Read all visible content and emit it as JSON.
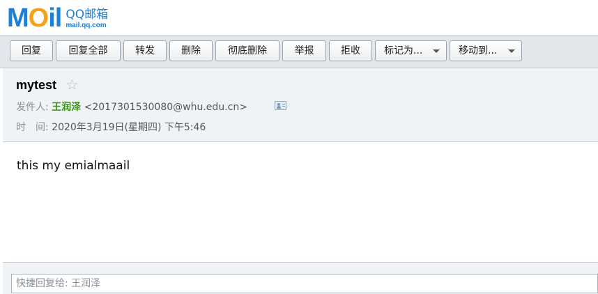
{
  "logo": {
    "mark": {
      "m": "M",
      "o": "O",
      "il": "il"
    },
    "brand": "QQ邮箱",
    "domain": "mail.qq.com"
  },
  "toolbar": {
    "buttons": [
      {
        "label": "回复"
      },
      {
        "label": "回复全部"
      },
      {
        "label": "转发"
      },
      {
        "label": "删除"
      },
      {
        "label": "彻底删除"
      },
      {
        "label": "举报"
      },
      {
        "label": "拒收"
      },
      {
        "label": "标记为...",
        "dropdown": true
      },
      {
        "label": "移动到...",
        "dropdown": true
      }
    ]
  },
  "message": {
    "subject": "mytest",
    "star_icon": "star-outline-icon",
    "from_label": "发件人:",
    "sender_name": "王润泽",
    "sender_email": "<2017301530080@whu.edu.cn>",
    "time_label": "时　间:",
    "time_value": "2020年3月19日(星期四) 下午5:46",
    "body": "this my emialmaail"
  },
  "quick_reply": {
    "placeholder": "快捷回复给: 王润泽"
  },
  "colors": {
    "accent": "#1f7fd4",
    "logo_orange": "#f6a11a",
    "sender_green": "#3b8f1b",
    "toolbar_bg": "#e3e6ea",
    "header_bg": "#f0f3f6"
  }
}
